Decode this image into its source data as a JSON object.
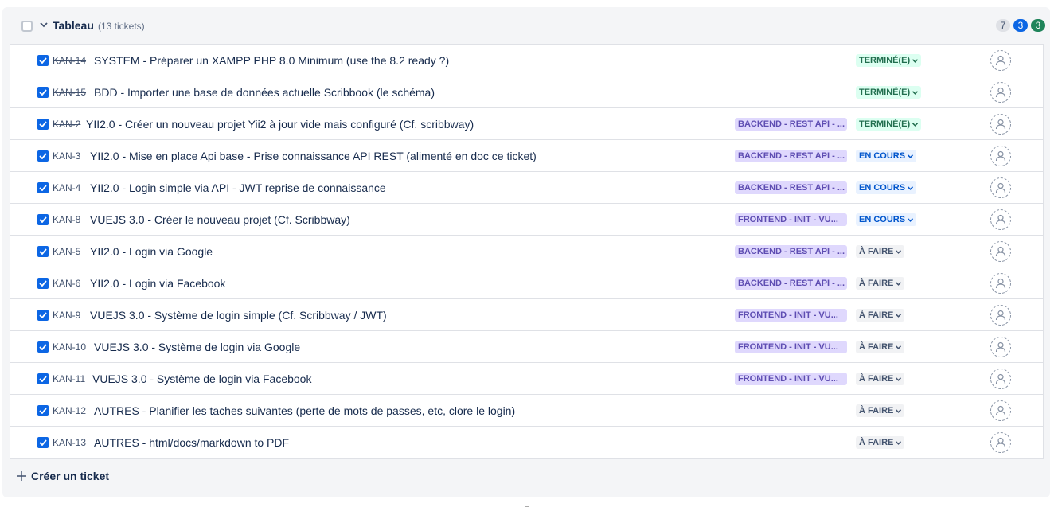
{
  "board": {
    "title": "Tableau",
    "count": "(13 tickets)",
    "badges": [
      {
        "value": "7",
        "color": "#dfe1e6"
      },
      {
        "value": "3",
        "color": "#0c66e4"
      },
      {
        "value": "3",
        "color": "#1f845a"
      }
    ]
  },
  "tickets": [
    {
      "key": "KAN-14",
      "summary": "SYSTEM - Préparer un XAMPP PHP 8.0 Minimum (use the 8.2 ready ?)",
      "epic": "",
      "status": "TERMINÉ(E)",
      "status_type": "done",
      "checked": true
    },
    {
      "key": "KAN-15",
      "summary": "BDD - Importer une base de données actuelle Scribbook (le schéma)",
      "epic": "",
      "status": "TERMINÉ(E)",
      "status_type": "done",
      "checked": true
    },
    {
      "key": "KAN-2",
      "summary": "YII2.0 - Créer un nouveau projet Yii2 à jour vide mais configuré (Cf. scribbway)",
      "epic": "BACKEND - REST API - ...",
      "status": "TERMINÉ(E)",
      "status_type": "done",
      "checked": true
    },
    {
      "key": "KAN-3",
      "summary": "YII2.0 - Mise en place Api base - Prise connaissance API REST (alimenté en doc ce ticket)",
      "epic": "BACKEND - REST API - ...",
      "status": "EN COURS",
      "status_type": "inprogress",
      "checked": true
    },
    {
      "key": "KAN-4",
      "summary": "YII2.0 - Login simple via API - JWT reprise de connaissance",
      "epic": "BACKEND - REST API - ...",
      "status": "EN COURS",
      "status_type": "inprogress",
      "checked": true
    },
    {
      "key": "KAN-8",
      "summary": "VUEJS 3.0 - Créer le nouveau projet (Cf. Scribbway)",
      "epic": "FRONTEND - INIT - VU...",
      "status": "EN COURS",
      "status_type": "inprogress",
      "checked": true
    },
    {
      "key": "KAN-5",
      "summary": "YII2.0 - Login via Google",
      "epic": "BACKEND - REST API - ...",
      "status": "À FAIRE",
      "status_type": "todo",
      "checked": true
    },
    {
      "key": "KAN-6",
      "summary": "YII2.0 - Login via Facebook",
      "epic": "BACKEND - REST API - ...",
      "status": "À FAIRE",
      "status_type": "todo",
      "checked": true
    },
    {
      "key": "KAN-9",
      "summary": "VUEJS 3.0 - Système de login simple (Cf. Scribbway / JWT)",
      "epic": "FRONTEND - INIT - VU...",
      "status": "À FAIRE",
      "status_type": "todo",
      "checked": true
    },
    {
      "key": "KAN-10",
      "summary": "VUEJS 3.0 - Système de login via Google",
      "epic": "FRONTEND - INIT - VU...",
      "status": "À FAIRE",
      "status_type": "todo",
      "checked": true
    },
    {
      "key": "KAN-11",
      "summary": "VUEJS 3.0 - Système de login via Facebook",
      "epic": "FRONTEND - INIT - VU...",
      "status": "À FAIRE",
      "status_type": "todo",
      "checked": true
    },
    {
      "key": "KAN-12",
      "summary": "AUTRES - Planifier les taches suivantes (perte de mots de passes, etc, clore le login)",
      "epic": "",
      "status": "À FAIRE",
      "status_type": "todo",
      "checked": true
    },
    {
      "key": "KAN-13",
      "summary": "AUTRES - html/docs/markdown to PDF",
      "epic": "",
      "status": "À FAIRE",
      "status_type": "todo",
      "checked": true
    }
  ],
  "create": {
    "label": "Créer un ticket",
    "icon": "plus-icon"
  },
  "colors": {
    "accent": "#0c66e4",
    "done_bg": "#dcfff1",
    "inprogress_bg": "#e9f2ff",
    "todo_bg": "#f1f2f4",
    "epic_bg": "#dfd8fd"
  }
}
